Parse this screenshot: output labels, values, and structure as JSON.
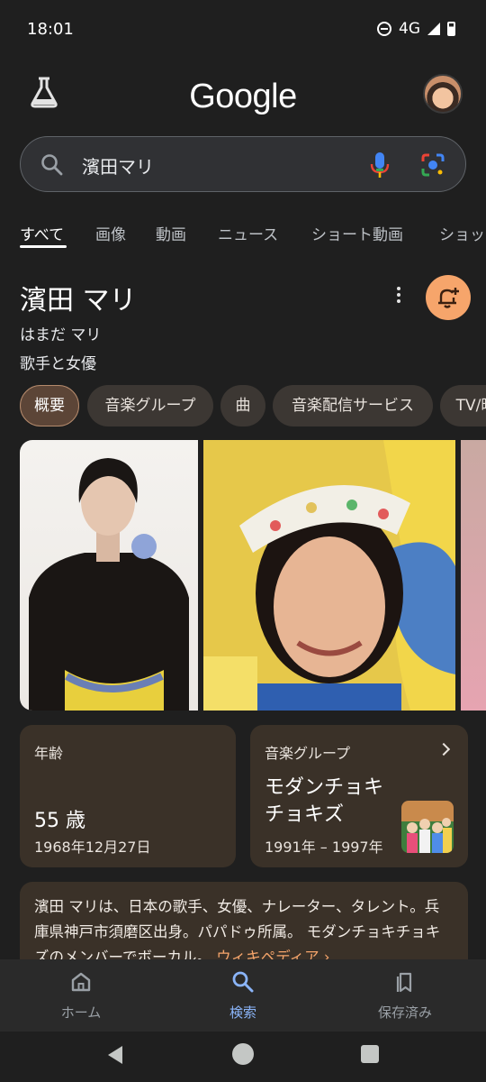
{
  "status_bar": {
    "time": "18:01",
    "network": "4G"
  },
  "header": {
    "logo_text": "Google"
  },
  "search": {
    "query": "濱田マリ"
  },
  "tabs": [
    "すべて",
    "画像",
    "動画",
    "ニュース",
    "ショート動画",
    "ショッ"
  ],
  "entity": {
    "name": "濱田 マリ",
    "reading": "はまだ マリ",
    "description": "歌手と女優"
  },
  "chips": [
    "概要",
    "音楽グループ",
    "曲",
    "音楽配信サービス",
    "TV/映"
  ],
  "age_card": {
    "label": "年齢",
    "value": "55 歳",
    "birthdate": "1968年12月27日"
  },
  "group_card": {
    "label": "音楽グループ",
    "name": "モダンチョキチョキズ",
    "years": "1991年 – 1997年"
  },
  "summary": {
    "text": "濱田 マリは、日本の歌手、女優、ナレーター、タレント。兵庫県神戸市須磨区出身。パパドゥ所属。 モダンチョキチョキズのメンバーでボーカル。",
    "link": "ウィキペディア ›"
  },
  "bottom_nav": {
    "home": "ホーム",
    "search": "検索",
    "saved": "保存済み"
  },
  "colors": {
    "accent": "#f6a56b",
    "active_nav": "#8ab4f8",
    "card_bg": "#3a3128"
  }
}
